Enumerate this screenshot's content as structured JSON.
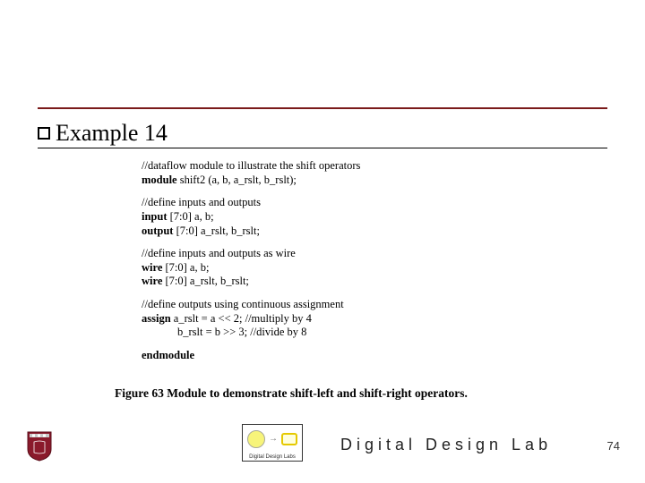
{
  "heading": "Example 14",
  "code": {
    "l1": "//dataflow module to illustrate the shift operators",
    "l2a": "module",
    "l2b": " shift2 (a, b, a_rslt, b_rslt);",
    "l3": "//define inputs and outputs",
    "l4a": "input",
    "l4b": " [7:0] a, b;",
    "l5a": "output",
    "l5b": " [7:0] a_rslt, b_rslt;",
    "l6": "//define inputs and outputs as wire",
    "l7a": "wire",
    "l7b": " [7:0] a, b;",
    "l8a": "wire",
    "l8b": " [7:0] a_rslt, b_rslt;",
    "l9": "//define outputs using continuous assignment",
    "l10a": "assign",
    "l10b": "   a_rslt = a << 2;     //multiply by 4",
    "l11": "b_rslt = b >> 3;    //divide by 8",
    "l12": "endmodule"
  },
  "caption": "Figure 63 Module to demonstrate shift-left and shift-right operators.",
  "lab_logo_text": "Digital Design Labs",
  "footer_title": "Digital Design Lab",
  "page_number": "74"
}
